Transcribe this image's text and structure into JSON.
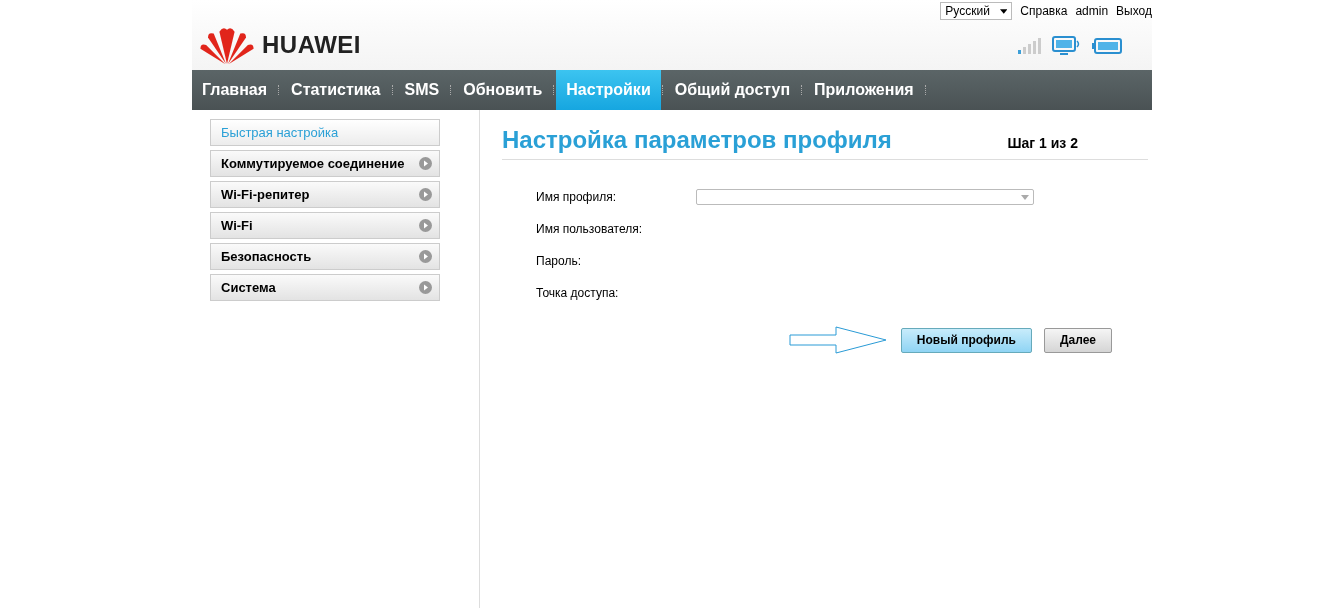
{
  "header": {
    "logo_text": "HUAWEI",
    "language": "Русский",
    "links": [
      "Справка",
      "admin",
      "Выход"
    ]
  },
  "nav": [
    {
      "label": "Главная",
      "selected": false
    },
    {
      "label": "Статистика",
      "selected": false
    },
    {
      "label": "SMS",
      "selected": false
    },
    {
      "label": "Обновить",
      "selected": false
    },
    {
      "label": "Настройки",
      "selected": true
    },
    {
      "label": "Общий доступ",
      "selected": false
    },
    {
      "label": "Приложения",
      "selected": false
    }
  ],
  "sidebar": {
    "items": [
      {
        "label": "Быстрая настройка",
        "selected": true
      },
      {
        "label": "Коммутируемое соединение",
        "selected": false
      },
      {
        "label": "Wi-Fi-репитер",
        "selected": false
      },
      {
        "label": "Wi-Fi",
        "selected": false
      },
      {
        "label": "Безопасность",
        "selected": false
      },
      {
        "label": "Система",
        "selected": false
      }
    ]
  },
  "content": {
    "title": "Настройка параметров профиля",
    "step": "Шаг 1 из 2",
    "fields": [
      {
        "label": "Имя профиля:",
        "kind": "select"
      },
      {
        "label": "Имя пользователя:",
        "kind": "label"
      },
      {
        "label": "Пароль:",
        "kind": "label"
      },
      {
        "label": "Точка доступа:",
        "kind": "label"
      }
    ],
    "buttons": [
      {
        "label": "Новый профиль",
        "kind": "primary"
      },
      {
        "label": "Далее",
        "kind": "default"
      }
    ]
  }
}
